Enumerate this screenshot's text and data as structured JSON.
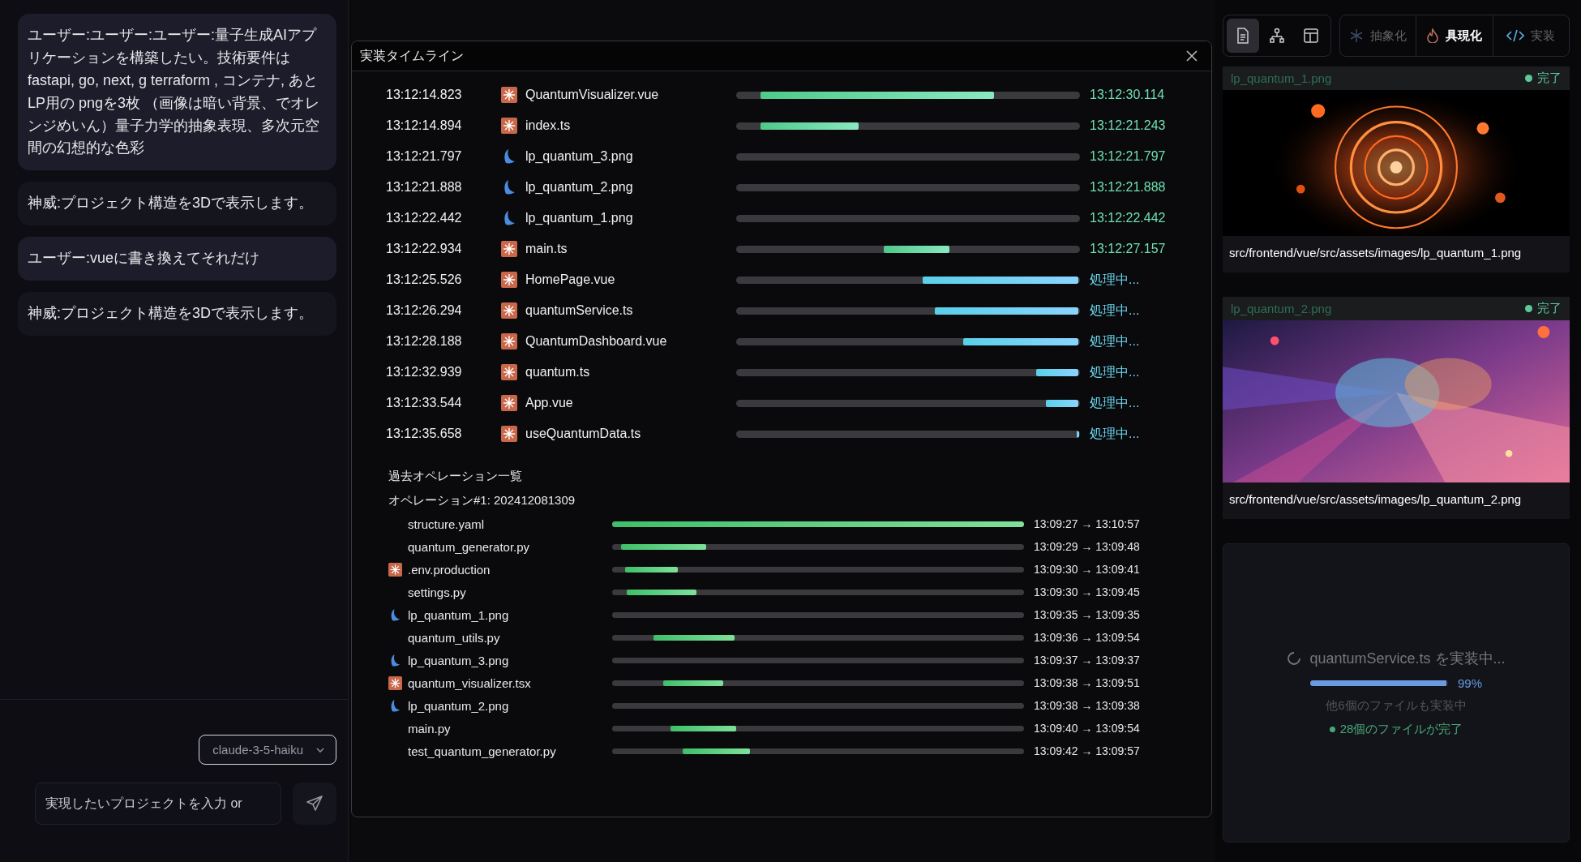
{
  "chat": {
    "messages": [
      {
        "text": "ユーザー:ユーザー:ユーザー:量子生成AIアプリケーションを構築したい。技術要件は fastapi, go, next, g terraform , コンテナ, あと LP用の pngを3枚 （画像は暗い背景、でオレンジめいん）量子力学的抽象表現、多次元空間の幻想的な色彩",
        "highlighted": true
      },
      {
        "text": "神威:プロジェクト構造を3Dで表示します。",
        "highlighted": false
      },
      {
        "text": "ユーザー:vueに書き換えてそれだけ",
        "highlighted": true
      },
      {
        "text": "神威:プロジェクト構造を3Dで表示します。",
        "highlighted": false
      }
    ],
    "model_select": {
      "value": "claude-3-5-haiku"
    },
    "input": {
      "placeholder": "実現したいプロジェクトを入力 or"
    }
  },
  "timeline": {
    "title": "実装タイムライン",
    "current": [
      {
        "start": "13:12:14.823",
        "kind": "spark",
        "file": "QuantumVisualizer.vue",
        "in_progress": false,
        "end": "13:12:30.114"
      },
      {
        "start": "13:12:14.894",
        "kind": "spark",
        "file": "index.ts",
        "in_progress": false,
        "end": "13:12:21.243"
      },
      {
        "start": "13:12:21.797",
        "file": "lp_quantum_3.png",
        "in_progress": false,
        "end": "13:12:21.797"
      },
      {
        "start": "13:12:21.888",
        "file": "lp_quantum_2.png",
        "in_progress": false,
        "end": "13:12:21.888"
      },
      {
        "start": "13:12:22.442",
        "file": "lp_quantum_1.png",
        "in_progress": false,
        "end": "13:12:22.442"
      },
      {
        "start": "13:12:22.934",
        "kind": "spark",
        "file": "main.ts",
        "in_progress": false,
        "end": "13:12:27.157"
      },
      {
        "start": "13:12:25.526",
        "kind": "spark",
        "file": "HomePage.vue",
        "in_progress": true,
        "end": "処理中..."
      },
      {
        "start": "13:12:26.294",
        "kind": "spark",
        "file": "quantumService.ts",
        "in_progress": true,
        "end": "処理中..."
      },
      {
        "start": "13:12:28.188",
        "kind": "spark",
        "file": "QuantumDashboard.vue",
        "in_progress": true,
        "end": "処理中..."
      },
      {
        "start": "13:12:32.939",
        "kind": "spark",
        "file": "quantum.ts",
        "in_progress": true,
        "end": "処理中..."
      },
      {
        "start": "13:12:33.544",
        "kind": "spark",
        "file": "App.vue",
        "in_progress": true,
        "end": "処理中..."
      },
      {
        "start": "13:12:35.658",
        "kind": "spark",
        "file": "useQuantumData.ts",
        "in_progress": true,
        "end": "処理中..."
      }
    ],
    "history_title": "過去オペレーション一覧",
    "operations": [
      {
        "title": "オペレーション#1: 202412081309",
        "files": [
          {
            "file": "structure.yaml",
            "time": "13:09:27 → 13:10:57"
          },
          {
            "file": "quantum_generator.py",
            "time": "13:09:29 → 13:09:48"
          },
          {
            "file": ".env.production",
            "kind": "spark",
            "time": "13:09:30 → 13:09:41"
          },
          {
            "file": "settings.py",
            "time": "13:09:30 → 13:09:45"
          },
          {
            "file": "lp_quantum_1.png",
            "time": "13:09:35 → 13:09:35"
          },
          {
            "file": "quantum_utils.py",
            "time": "13:09:36 → 13:09:54"
          },
          {
            "file": "lp_quantum_3.png",
            "time": "13:09:37 → 13:09:37"
          },
          {
            "file": "quantum_visualizer.tsx",
            "kind": "spark",
            "time": "13:09:38 → 13:09:51"
          },
          {
            "file": "lp_quantum_2.png",
            "time": "13:09:38 → 13:09:38"
          },
          {
            "file": "main.py",
            "time": "13:09:40 → 13:09:54"
          },
          {
            "file": "test_quantum_generator.py",
            "time": "13:09:42 → 13:09:57"
          }
        ]
      }
    ]
  },
  "workspace": {
    "view_buttons": [
      {
        "kind": "document",
        "selected": true
      },
      {
        "kind": "hierarchy",
        "selected": false
      },
      {
        "kind": "layout",
        "selected": false
      }
    ],
    "modes": [
      {
        "kind": "snowflake",
        "label": "抽象化",
        "selected": false
      },
      {
        "kind": "flame",
        "label": "具現化",
        "selected": true
      },
      {
        "kind": "code",
        "label": "実装",
        "selected": false
      }
    ],
    "assets": [
      {
        "name": "lp_quantum_1.png",
        "status": "完了",
        "path": "src/frontend/vue/src/assets/images/lp_quantum_1.png"
      },
      {
        "name": "lp_quantum_2.png",
        "status": "完了",
        "path": "src/frontend/vue/src/assets/images/lp_quantum_2.png"
      }
    ],
    "progress": {
      "label": "quantumService.ts を実装中...",
      "level": 0.99,
      "percent": "99%",
      "others": "他6個のファイルも実装中",
      "done": "28個のファイルが完了"
    }
  }
}
